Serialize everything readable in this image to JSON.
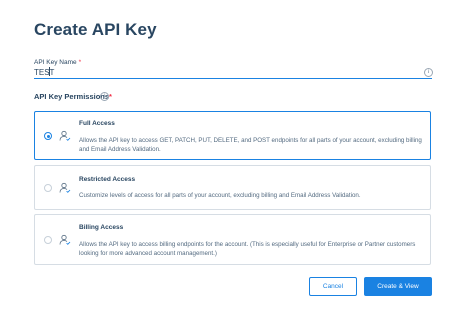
{
  "page": {
    "title": "Create API Key"
  },
  "api_key_name": {
    "label": "API Key Name",
    "required_marker": "*",
    "value": "TEST",
    "info_icon": "info-icon"
  },
  "permissions": {
    "heading": "API Key Permissions",
    "required_marker": "*",
    "info_icon": "info-icon",
    "selected": "full_access",
    "options": [
      {
        "id": "full_access",
        "title": "Full Access",
        "description": "Allows the API key to access GET, PATCH, PUT, DELETE, and POST endpoints for all parts of your account, excluding billing and Email Address Validation.",
        "icon": "user-icon"
      },
      {
        "id": "restricted_access",
        "title": "Restricted Access",
        "description": "Customize levels of access for all parts of your account, excluding billing and Email Address Validation.",
        "icon": "user-icon"
      },
      {
        "id": "billing_access",
        "title": "Billing Access",
        "description": "Allows the API key to access billing endpoints for the account. (This is especially useful for Enterprise or Partner customers looking for more advanced account management.)",
        "icon": "user-icon"
      }
    ]
  },
  "actions": {
    "cancel_label": "Cancel",
    "create_label": "Create & View"
  },
  "colors": {
    "accent": "#1a82e2",
    "heading": "#294661",
    "body_text": "#546b81",
    "required": "#f22f46",
    "border": "#d6dde4"
  }
}
